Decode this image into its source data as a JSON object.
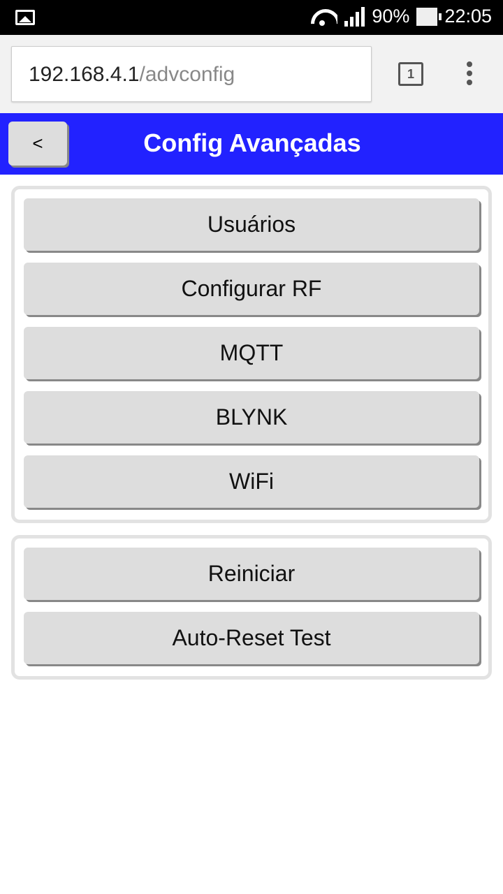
{
  "status_bar": {
    "battery": "90%",
    "time": "22:05",
    "icons": [
      "gallery-icon",
      "wifi-icon",
      "signal-icon",
      "battery-icon"
    ]
  },
  "browser": {
    "url_host": "192.168.4.1",
    "url_path": "/advconfig",
    "tab_count": "1"
  },
  "header": {
    "back_label": "<",
    "title": "Config Avançadas",
    "color": "#2222ff"
  },
  "groups": [
    {
      "buttons": [
        "Usuários",
        "Configurar RF",
        "MQTT",
        "BLYNK",
        "WiFi"
      ]
    },
    {
      "buttons": [
        "Reiniciar",
        "Auto-Reset Test"
      ]
    }
  ]
}
